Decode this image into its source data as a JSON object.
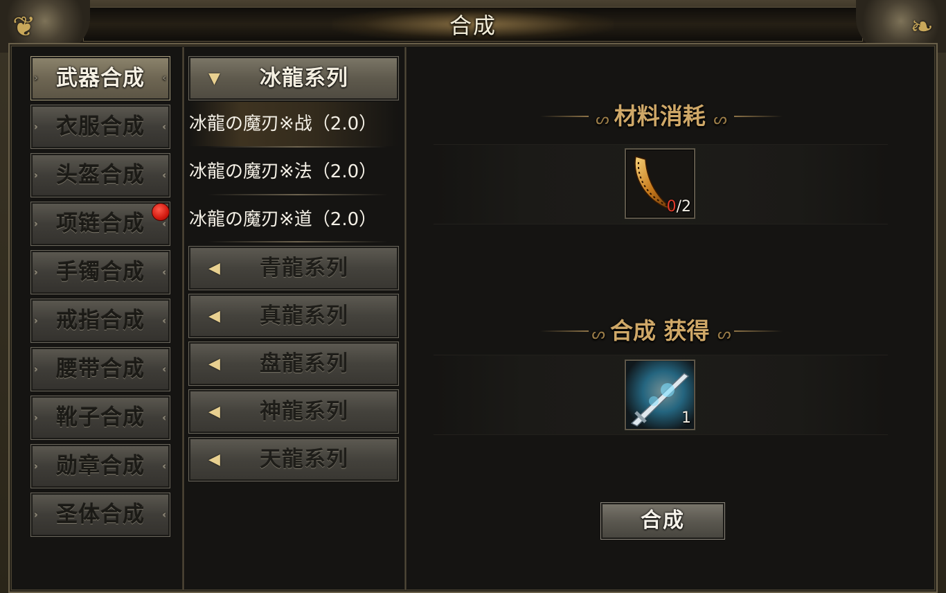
{
  "window": {
    "title": "合成"
  },
  "categories": [
    {
      "label": "武器合成",
      "active": true
    },
    {
      "label": "衣服合成",
      "active": false
    },
    {
      "label": "头盔合成",
      "active": false
    },
    {
      "label": "项链合成",
      "active": false,
      "badge": "red-dot"
    },
    {
      "label": "手镯合成",
      "active": false
    },
    {
      "label": "戒指合成",
      "active": false
    },
    {
      "label": "腰带合成",
      "active": false
    },
    {
      "label": "靴子合成",
      "active": false
    },
    {
      "label": "勋章合成",
      "active": false
    },
    {
      "label": "圣体合成",
      "active": false
    }
  ],
  "series": {
    "open": {
      "label": "冰龍系列",
      "icon": "triangle-down-icon",
      "items": [
        {
          "label": "冰龍の魔刃※战（2.0）",
          "selected": true
        },
        {
          "label": "冰龍の魔刃※法（2.0）",
          "selected": false
        },
        {
          "label": "冰龍の魔刃※道（2.0）",
          "selected": false
        }
      ]
    },
    "collapsed": [
      {
        "label": "青龍系列",
        "icon": "triangle-left-icon"
      },
      {
        "label": "真龍系列",
        "icon": "triangle-left-icon"
      },
      {
        "label": "盘龍系列",
        "icon": "triangle-left-icon"
      },
      {
        "label": "神龍系列",
        "icon": "triangle-left-icon"
      },
      {
        "label": "天龍系列",
        "icon": "triangle-left-icon"
      }
    ]
  },
  "materials": {
    "title": "材料消耗",
    "item": {
      "icon": "golden-crescent-blade-icon",
      "have": "0",
      "need": "/2"
    }
  },
  "result": {
    "title": "合成 获得",
    "item": {
      "icon": "ice-sword-icon",
      "count": "1"
    }
  },
  "actions": {
    "craft_label": "合成"
  },
  "colors": {
    "accent_gold": "#cfa868",
    "badge_red": "#d11a10",
    "have_red": "#e23b2a"
  }
}
